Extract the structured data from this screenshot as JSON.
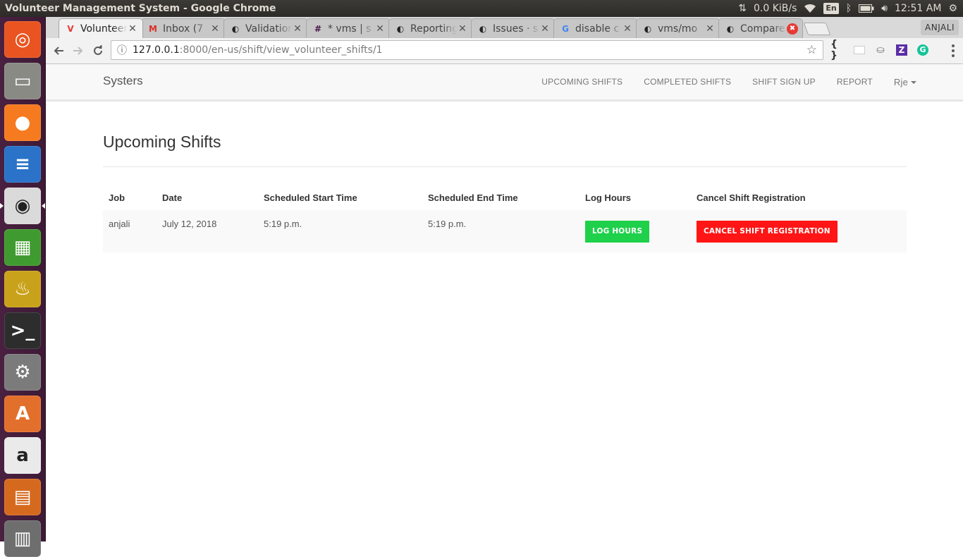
{
  "system": {
    "window_title": "Volunteer Management System - Google Chrome",
    "net_speed": "0.0 KiB/s",
    "keyboard": "En",
    "time": "12:51 AM"
  },
  "launcher": [
    {
      "name": "ubuntu-dash-icon",
      "bg": "#e95420",
      "glyph": "◎"
    },
    {
      "name": "files-icon",
      "bg": "#8a8a84",
      "glyph": "▭"
    },
    {
      "name": "firefox-icon",
      "bg": "#f67a1f",
      "glyph": "●"
    },
    {
      "name": "writer-icon",
      "bg": "#2a73c9",
      "glyph": "≡"
    },
    {
      "name": "chrome-icon",
      "bg": "#dadada",
      "glyph": "◉"
    },
    {
      "name": "calc-icon",
      "bg": "#3f9b2f",
      "glyph": "▦"
    },
    {
      "name": "genie-lamp-icon",
      "bg": "#c9a21b",
      "glyph": "♨"
    },
    {
      "name": "terminal-icon",
      "bg": "#2d2d2d",
      "glyph": ">_"
    },
    {
      "name": "settings-icon",
      "bg": "#7b7b7b",
      "glyph": "⚙"
    },
    {
      "name": "software-center-icon",
      "bg": "#e36f2c",
      "glyph": "A"
    },
    {
      "name": "amazon-icon",
      "bg": "#eaeaea",
      "glyph": "a"
    },
    {
      "name": "impress-icon",
      "bg": "#d56a1f",
      "glyph": "▤"
    },
    {
      "name": "workspace-icon",
      "bg": "#6e6e6e",
      "glyph": "▥"
    }
  ],
  "browser": {
    "tabs": [
      {
        "label": "Volunteer Management System",
        "fav": "V",
        "favcolor": "#e53935",
        "active": true
      },
      {
        "label": "Inbox (7",
        "fav": "M",
        "favcolor": "#d93025"
      },
      {
        "label": "Validation",
        "fav": "◐",
        "favcolor": "#222"
      },
      {
        "label": "* vms | s",
        "fav": "#",
        "favcolor": "#4a154b"
      },
      {
        "label": "Reporting",
        "fav": "◐",
        "favcolor": "#222"
      },
      {
        "label": "Issues · s",
        "fav": "◐",
        "favcolor": "#222"
      },
      {
        "label": "disable c",
        "fav": "G",
        "favcolor": "#4285f4"
      },
      {
        "label": "vms/mo",
        "fav": "◐",
        "favcolor": "#222"
      },
      {
        "label": "Compare",
        "fav": "◐",
        "favcolor": "#222"
      }
    ],
    "profile": "ANJALI",
    "url_host": "127.0.0.1",
    "url_path": ":8000/en-us/shift/view_volunteer_shifts/1"
  },
  "app": {
    "brand": "Systers",
    "nav": {
      "upcoming": "UPCOMING SHIFTS",
      "completed": "COMPLETED SHIFTS",
      "signup": "SHIFT SIGN UP",
      "report": "REPORT",
      "user": "Rje"
    },
    "heading": "Upcoming Shifts",
    "table": {
      "headers": [
        "Job",
        "Date",
        "Scheduled Start Time",
        "Scheduled End Time",
        "Log Hours",
        "Cancel Shift Registration"
      ],
      "rows": [
        {
          "job": "anjali",
          "date": "July 12, 2018",
          "start": "5:19 p.m.",
          "end": "5:19 p.m.",
          "log_label": "LOG HOURS",
          "cancel_label": "CANCEL SHIFT REGISTRATION"
        }
      ]
    }
  }
}
